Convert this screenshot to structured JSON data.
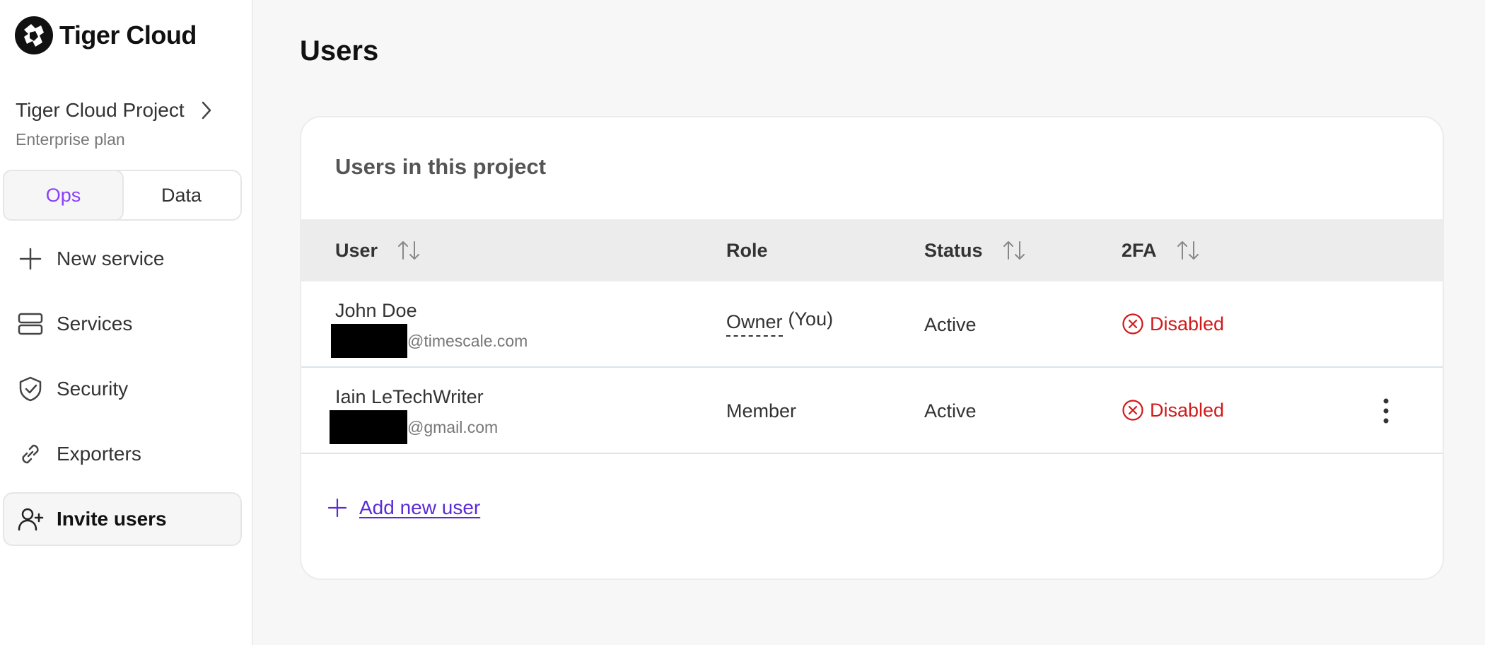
{
  "brand": {
    "name": "Tiger Cloud"
  },
  "project": {
    "name": "Tiger Cloud Project",
    "plan": "Enterprise plan"
  },
  "mode_toggle": {
    "options": [
      "Ops",
      "Data"
    ],
    "selected": "Ops"
  },
  "nav": {
    "items": [
      {
        "label": "New service",
        "icon": "plus-icon"
      },
      {
        "label": "Services",
        "icon": "server-icon"
      },
      {
        "label": "Security",
        "icon": "shield-check-icon"
      },
      {
        "label": "Exporters",
        "icon": "link-icon"
      },
      {
        "label": "Invite users",
        "icon": "user-plus-icon",
        "active": true
      }
    ]
  },
  "page": {
    "title": "Users"
  },
  "users_card": {
    "title": "Users in this project",
    "columns": [
      "User",
      "Role",
      "Status",
      "2FA"
    ],
    "rows": [
      {
        "name": "John Doe",
        "email_domain": "@timescale.com",
        "role": "Owner",
        "role_note": "(You)",
        "status": "Active",
        "tfa": "Disabled"
      },
      {
        "name": "Iain LeTechWriter",
        "email_domain": "@gmail.com",
        "role": "Member",
        "status": "Active",
        "tfa": "Disabled"
      }
    ],
    "add_label": "Add new user"
  },
  "colors": {
    "accent": "#8a3ffc",
    "link": "#5b2bd6",
    "danger": "#d11a1a"
  }
}
